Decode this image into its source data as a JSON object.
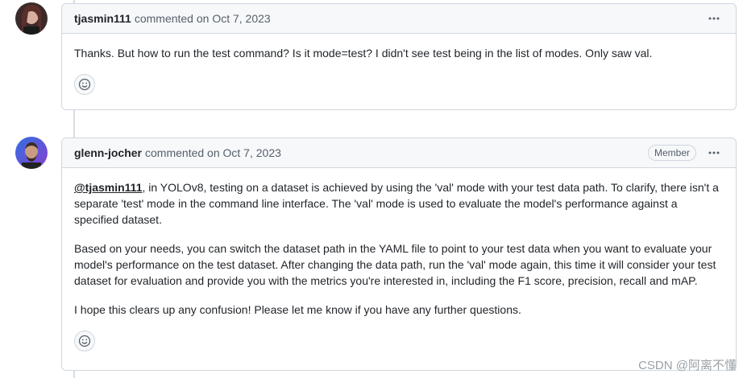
{
  "comments": [
    {
      "author": "tjasmin111",
      "meta": "commented on Oct 7, 2023",
      "paragraphs": [
        "Thanks. But how to run the test command? Is it mode=test? I didn't see test being in the list of modes. Only saw val."
      ]
    },
    {
      "author": "glenn-jocher",
      "meta": "commented on Oct 7, 2023",
      "badge": "Member",
      "mention": "@tjasmin111",
      "p1_rest": ", in YOLOv8, testing on a dataset is achieved by using the 'val' mode with your test data path. To clarify, there isn't a separate 'test' mode in the command line interface. The 'val' mode is used to evaluate the model's performance against a specified dataset.",
      "p2": "Based on your needs, you can switch the dataset path in the YAML file to point to your test data when you want to evaluate your model's performance on the test dataset. After changing the data path, run the 'val' mode again, this time it will consider your test dataset for evaluation and provide you with the metrics you're interested in, including the F1 score, precision, recall and mAP.",
      "p3": "I hope this clears up any confusion! Please let me know if you have any further questions."
    }
  ],
  "watermark": "CSDN @阿离不懂",
  "icons": {
    "more": "kebab-horizontal-icon",
    "reaction": "smiley-icon"
  },
  "colors": {
    "border": "#d0d7de",
    "header_bg": "#f6f8fa",
    "muted": "#57606a"
  }
}
